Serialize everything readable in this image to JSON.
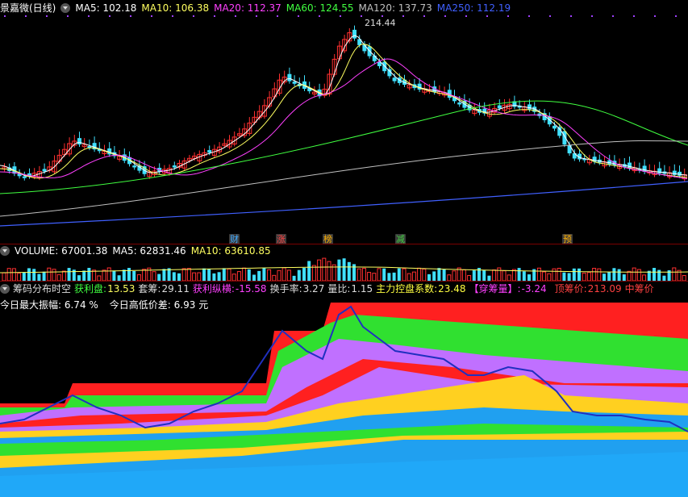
{
  "header": {
    "name": "景嘉微(日线)",
    "ma5": "MA5: 102.18",
    "ma10": "MA10: 106.38",
    "ma20": "MA20: 112.37",
    "ma60": "MA60: 124.55",
    "ma120": "MA120: 137.73",
    "ma250": "MA250: 112.19",
    "high_label": "214.44"
  },
  "markers": [
    {
      "text": "财",
      "color": "#3fa9ff"
    },
    {
      "text": "涨",
      "color": "#ff4040"
    },
    {
      "text": "榜",
      "color": "#ffb000"
    },
    {
      "text": "减",
      "color": "#40d040"
    },
    {
      "text": "预",
      "color": "#ffb000"
    }
  ],
  "volume": {
    "label": "VOLUME: 67001.38",
    "ma5": "MA5: 62831.46",
    "ma10": "MA10: 63610.85"
  },
  "chip": {
    "title": "筹码分布时空",
    "profit_label": "获利盘:",
    "profit_value": "13.53",
    "lock_label": "套筹:",
    "lock_value": "29.11",
    "profit_pull_label": "获利纵横:",
    "profit_pull_value": "-15.58",
    "turnover_label": "换手率:",
    "turnover_value": "3.27",
    "volratio_label": "量比:",
    "volratio_value": "1.15",
    "control_label": "主力控盘系数:",
    "control_value": "23.48",
    "wear_label": "【穿筹量】:",
    "wear_value": "-3.24",
    "top_price_label": "顶筹价:",
    "top_price_value": "213.09",
    "mid_price_label": "中筹价"
  },
  "chip_info": {
    "amplitude": "今日最大振幅: 6.74 %",
    "hl_diff": "今日高低价差: 6.93 元"
  },
  "colors": {
    "up": "#ff3030",
    "down": "#40e0ff",
    "ma5": "#ffffff",
    "ma10": "#ffff60",
    "ma20": "#ff40ff",
    "ma60": "#40ff40",
    "ma120": "#c0c0c0",
    "ma250": "#4060ff"
  }
}
